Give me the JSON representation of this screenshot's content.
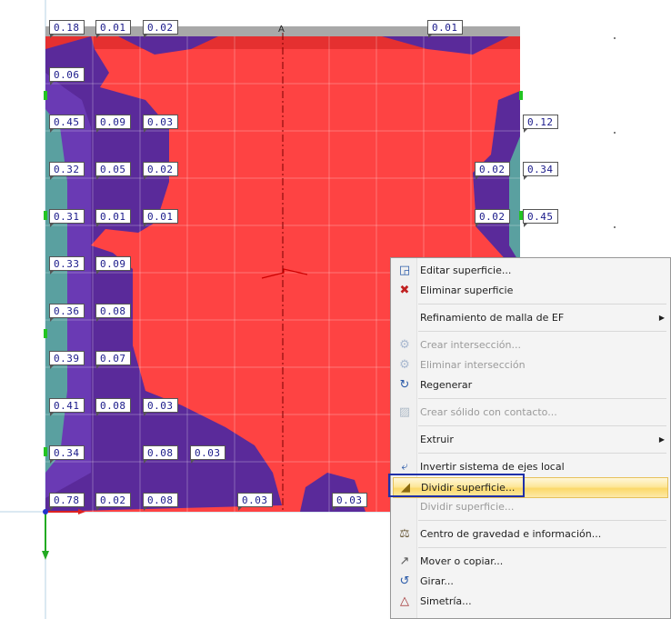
{
  "model_view": {
    "axis_label": "A",
    "results": {
      "top": [
        "0.18",
        "0.01",
        "0.02",
        "0.01"
      ],
      "row_0": [
        "0.06"
      ],
      "row_1": [
        "0.45",
        "0.09",
        "0.03",
        "0.12"
      ],
      "row_2": [
        "0.32",
        "0.05",
        "0.02",
        "0.02",
        "0.34"
      ],
      "row_3": [
        "0.31",
        "0.01",
        "0.01",
        "0.02",
        "0.45"
      ],
      "row_4": [
        "0.33",
        "0.09"
      ],
      "row_5": [
        "0.36",
        "0.08"
      ],
      "row_6": [
        "0.39",
        "0.07"
      ],
      "row_7": [
        "0.41",
        "0.08",
        "0.03"
      ],
      "row_8": [
        "0.34",
        "0.08",
        "0.03"
      ],
      "bottom": [
        "0.78",
        "0.02",
        "0.08",
        "0.03",
        "0.03"
      ]
    },
    "colors": {
      "surface": "#fe4343",
      "low": "#5a2a9a",
      "edge": "#5aa0a0"
    }
  },
  "context_menu": {
    "items": [
      {
        "label": "Editar superficie...",
        "icon": "edit-surface-icon",
        "enabled": true
      },
      {
        "label": "Eliminar superficie",
        "icon": "delete-surface-icon",
        "enabled": true
      },
      {
        "label": "Refinamiento de malla de EF",
        "icon": "",
        "enabled": true,
        "submenu": true
      },
      {
        "label": "Crear intersección...",
        "icon": "create-intersection-icon",
        "enabled": false
      },
      {
        "label": "Eliminar intersección",
        "icon": "delete-intersection-icon",
        "enabled": false
      },
      {
        "label": "Regenerar",
        "icon": "regenerate-icon",
        "enabled": true
      },
      {
        "label": "Crear sólido con contacto...",
        "icon": "solid-contact-icon",
        "enabled": false
      },
      {
        "label": "Extruir",
        "icon": "",
        "enabled": true,
        "submenu": true
      },
      {
        "label": "Invertir sistema de ejes local",
        "icon": "invert-axes-icon",
        "enabled": true
      },
      {
        "label": "Dividir superficie...",
        "icon": "divide-surface-icon",
        "enabled": true,
        "highlighted": true
      },
      {
        "label": "Dividir superficie...",
        "icon": "",
        "enabled": false
      },
      {
        "label": "Centro de gravedad e información...",
        "icon": "center-gravity-icon",
        "enabled": true
      },
      {
        "label": "Mover o copiar...",
        "icon": "move-copy-icon",
        "enabled": true
      },
      {
        "label": "Girar...",
        "icon": "rotate-icon",
        "enabled": true
      },
      {
        "label": "Simetría...",
        "icon": "mirror-icon",
        "enabled": true
      }
    ],
    "highlight_color": "#fbd96a",
    "focus_border_color": "#1f2fa8"
  }
}
